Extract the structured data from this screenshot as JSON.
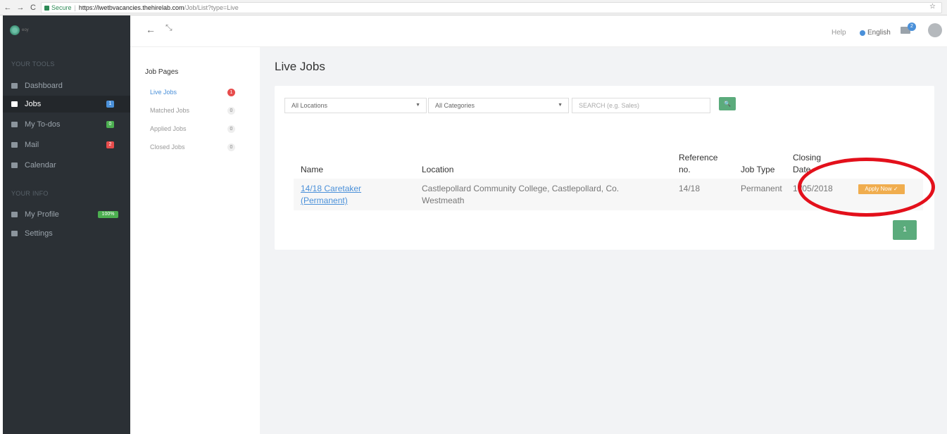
{
  "browser": {
    "back": "←",
    "forward": "→",
    "reload": "C",
    "secure_label": "Secure",
    "separator": "|",
    "url_host": "https://lwetbvacancies.thehirelab.com",
    "url_path": "/Job/List?type=Live",
    "star": "☆"
  },
  "sidebar": {
    "logo_text": "eoy",
    "tools_heading": "YOUR TOOLS",
    "items": [
      {
        "label": "Dashboard"
      },
      {
        "label": "Jobs",
        "badge": "1",
        "badge_color": "#4a90d9"
      },
      {
        "label": "My To-dos",
        "badge": "0",
        "badge_color": "#4caf50"
      },
      {
        "label": "Mail",
        "badge": "2",
        "badge_color": "#e74c4c"
      },
      {
        "label": "Calendar"
      }
    ],
    "info_heading": "YOUR INFO",
    "info_items": [
      {
        "label": "My Profile",
        "badge": "100%",
        "badge_color": "#4caf50"
      },
      {
        "label": "Settings"
      }
    ]
  },
  "header": {
    "back_icon": "←",
    "expand_icon": "⤡",
    "help": "Help",
    "language": "English",
    "mail_count": "2"
  },
  "job_pages": {
    "title": "Job Pages",
    "items": [
      {
        "label": "Live Jobs",
        "count": "1"
      },
      {
        "label": "Matched Jobs",
        "count": "0"
      },
      {
        "label": "Applied Jobs",
        "count": "0"
      },
      {
        "label": "Closed Jobs",
        "count": "0"
      }
    ]
  },
  "main": {
    "title": "Live Jobs",
    "filters": {
      "location": "All Locations",
      "category": "All Categories",
      "search_placeholder": "SEARCH (e.g. Sales)",
      "caret": "▼",
      "search_icon": "🔍"
    },
    "table": {
      "headers": {
        "name": "Name",
        "location": "Location",
        "reference_1": "Reference",
        "reference_2": "no.",
        "job_type": "Job Type",
        "closing_1": "Closing",
        "closing_2": "Date"
      },
      "rows": [
        {
          "name_1": "14/18 Caretaker",
          "name_2": "(Permanent)",
          "location_1": "Castlepollard Community College, Castlepollard, Co.",
          "location_2": "Westmeath",
          "reference": "14/18",
          "job_type": "Permanent",
          "closing_date": "1 /05/2018",
          "action": "Apply Now ✓"
        }
      ]
    },
    "pagination": [
      "1"
    ]
  },
  "colors": {
    "sidebar_bg": "#2b3035",
    "accent_green": "#5bab7c",
    "apply_orange": "#f0ad4e",
    "link_blue": "#4a90d9",
    "annotation_red": "#e3101b"
  }
}
